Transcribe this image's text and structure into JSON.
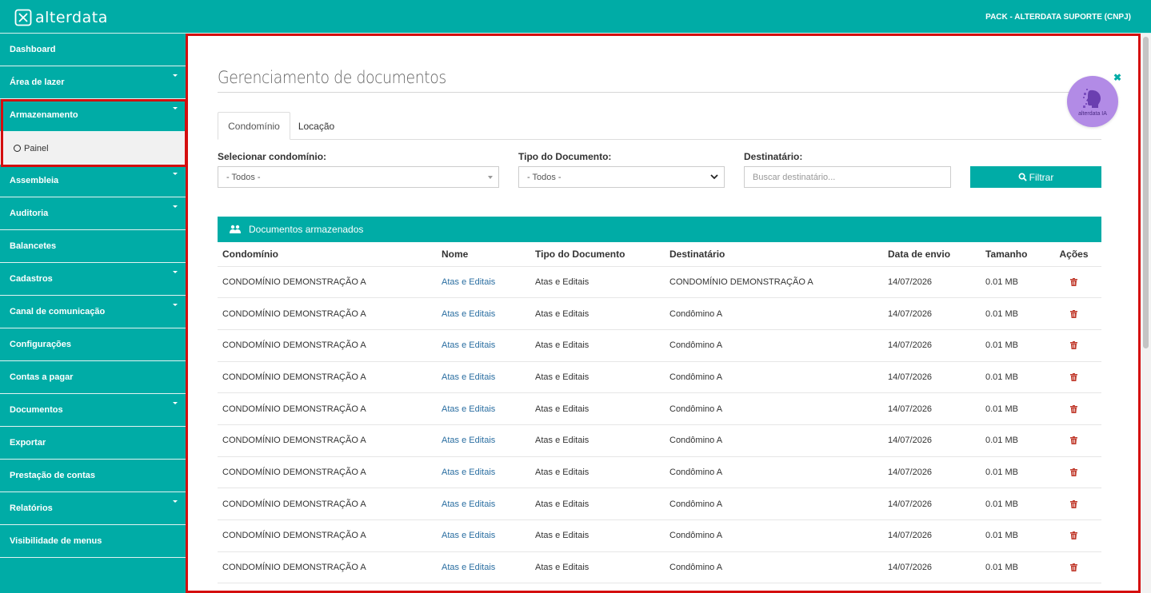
{
  "header": {
    "brand": "alterdata",
    "account": "PACK - ALTERDATA SUPORTE (CNPJ)"
  },
  "sidebar": {
    "items": [
      {
        "label": "Dashboard",
        "expandable": false
      },
      {
        "label": "Área de lazer",
        "expandable": true
      },
      {
        "label": "Armazenamento",
        "expandable": true
      },
      {
        "label": "Assembleia",
        "expandable": true
      },
      {
        "label": "Auditoria",
        "expandable": true
      },
      {
        "label": "Balancetes",
        "expandable": false
      },
      {
        "label": "Cadastros",
        "expandable": true
      },
      {
        "label": "Canal de comunicação",
        "expandable": true
      },
      {
        "label": "Configurações",
        "expandable": false
      },
      {
        "label": "Contas a pagar",
        "expandable": false
      },
      {
        "label": "Documentos",
        "expandable": true
      },
      {
        "label": "Exportar",
        "expandable": false
      },
      {
        "label": "Prestação de contas",
        "expandable": false
      },
      {
        "label": "Relatórios",
        "expandable": true
      },
      {
        "label": "Visibilidade de menus",
        "expandable": false
      }
    ],
    "submenu": {
      "label": "Painel"
    }
  },
  "main": {
    "title": "Gerenciamento de documentos",
    "ia_badge": "alterdata IA",
    "tabs": [
      {
        "label": "Condomínio",
        "active": true
      },
      {
        "label": "Locação",
        "active": false
      }
    ],
    "filters": {
      "condominio": {
        "label": "Selecionar condomínio:",
        "value": "- Todos -"
      },
      "tipo": {
        "label": "Tipo do Documento:",
        "value": "- Todos -"
      },
      "destinatario": {
        "label": "Destinatário:",
        "placeholder": "Buscar destinatário..."
      },
      "filter_button": "Filtrar"
    },
    "panel_title": "Documentos armazenados",
    "table": {
      "columns": [
        "Condomínio",
        "Nome",
        "Tipo do Documento",
        "Destinatário",
        "Data de envio",
        "Tamanho",
        "Ações"
      ],
      "rows": [
        [
          "CONDOMÍNIO DEMONSTRAÇÃO A",
          "Atas e Editais",
          "Atas e Editais",
          "CONDOMÍNIO DEMONSTRAÇÃO A",
          "14/07/2026",
          "0.01 MB"
        ],
        [
          "CONDOMÍNIO DEMONSTRAÇÃO A",
          "Atas e Editais",
          "Atas e Editais",
          "Condômino A",
          "14/07/2026",
          "0.01 MB"
        ],
        [
          "CONDOMÍNIO DEMONSTRAÇÃO A",
          "Atas e Editais",
          "Atas e Editais",
          "Condômino A",
          "14/07/2026",
          "0.01 MB"
        ],
        [
          "CONDOMÍNIO DEMONSTRAÇÃO A",
          "Atas e Editais",
          "Atas e Editais",
          "Condômino A",
          "14/07/2026",
          "0.01 MB"
        ],
        [
          "CONDOMÍNIO DEMONSTRAÇÃO A",
          "Atas e Editais",
          "Atas e Editais",
          "Condômino A",
          "14/07/2026",
          "0.01 MB"
        ],
        [
          "CONDOMÍNIO DEMONSTRAÇÃO A",
          "Atas e Editais",
          "Atas e Editais",
          "Condômino A",
          "14/07/2026",
          "0.01 MB"
        ],
        [
          "CONDOMÍNIO DEMONSTRAÇÃO A",
          "Atas e Editais",
          "Atas e Editais",
          "Condômino A",
          "14/07/2026",
          "0.01 MB"
        ],
        [
          "CONDOMÍNIO DEMONSTRAÇÃO A",
          "Atas e Editais",
          "Atas e Editais",
          "Condômino A",
          "14/07/2026",
          "0.01 MB"
        ],
        [
          "CONDOMÍNIO DEMONSTRAÇÃO A",
          "Atas e Editais",
          "Atas e Editais",
          "Condômino A",
          "14/07/2026",
          "0.01 MB"
        ],
        [
          "CONDOMÍNIO DEMONSTRAÇÃO A",
          "Atas e Editais",
          "Atas e Editais",
          "Condômino A",
          "14/07/2026",
          "0.01 MB"
        ]
      ]
    }
  },
  "colors": {
    "accent": "#00aca6",
    "highlight": "#d40e0e",
    "link": "#2a6ea1",
    "delete": "#c0392b"
  }
}
